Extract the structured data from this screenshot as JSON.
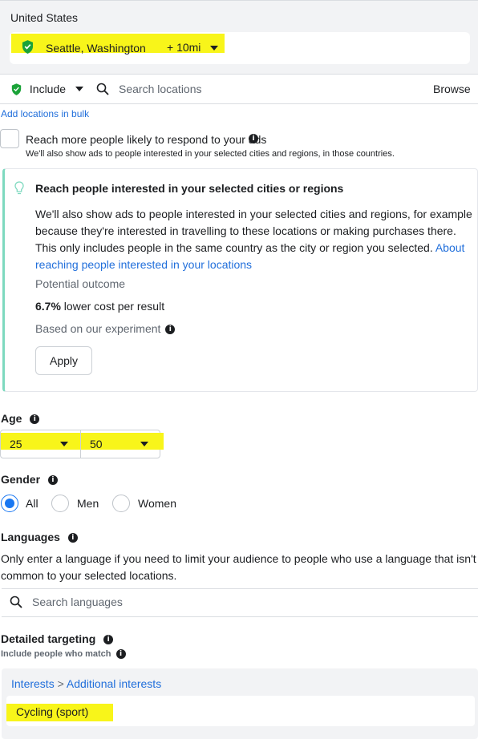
{
  "location_box": {
    "country": "United States",
    "city": "Seattle, Washington",
    "radius": "+ 10mi"
  },
  "location_search": {
    "include_label": "Include",
    "placeholder": "Search locations",
    "browse_label": "Browse",
    "bulk_link": "Add locations in bulk"
  },
  "reach_more": {
    "label": "Reach more people likely to respond to your ads",
    "sublabel": "We'll also show ads to people interested in your selected cities and regions, in those countries."
  },
  "suggestion_card": {
    "title": "Reach people interested in your selected cities or regions",
    "body": "We'll also show ads to people interested in your selected cities and regions, for example because they're interested in travelling to these locations or making purchases there. This only includes people in the same country as the city or region you selected. ",
    "link": "About reaching people interested in your locations",
    "outcome_label": "Potential outcome",
    "outcome_value": "6.7%",
    "outcome_text": " lower cost per result",
    "experiment_label": "Based on our experiment",
    "apply_label": "Apply"
  },
  "age": {
    "label": "Age",
    "min": "25",
    "max": "50"
  },
  "gender": {
    "label": "Gender",
    "options": [
      "All",
      "Men",
      "Women"
    ],
    "selected": "All"
  },
  "languages": {
    "label": "Languages",
    "help": "Only enter a language if you need to limit your audience to people who use a language that isn't common to your selected locations.",
    "placeholder": "Search languages"
  },
  "detailed_targeting": {
    "label": "Detailed targeting",
    "sublabel": "Include people who match",
    "breadcrumb": [
      "Interests",
      "Additional interests"
    ],
    "selected_interest": "Cycling (sport)"
  },
  "colors": {
    "highlight": "#f8f51a",
    "shield_green": "#1ba339",
    "link_blue": "#216fdb",
    "card_accent": "#7ed9bf",
    "radio_blue": "#1877f2"
  }
}
